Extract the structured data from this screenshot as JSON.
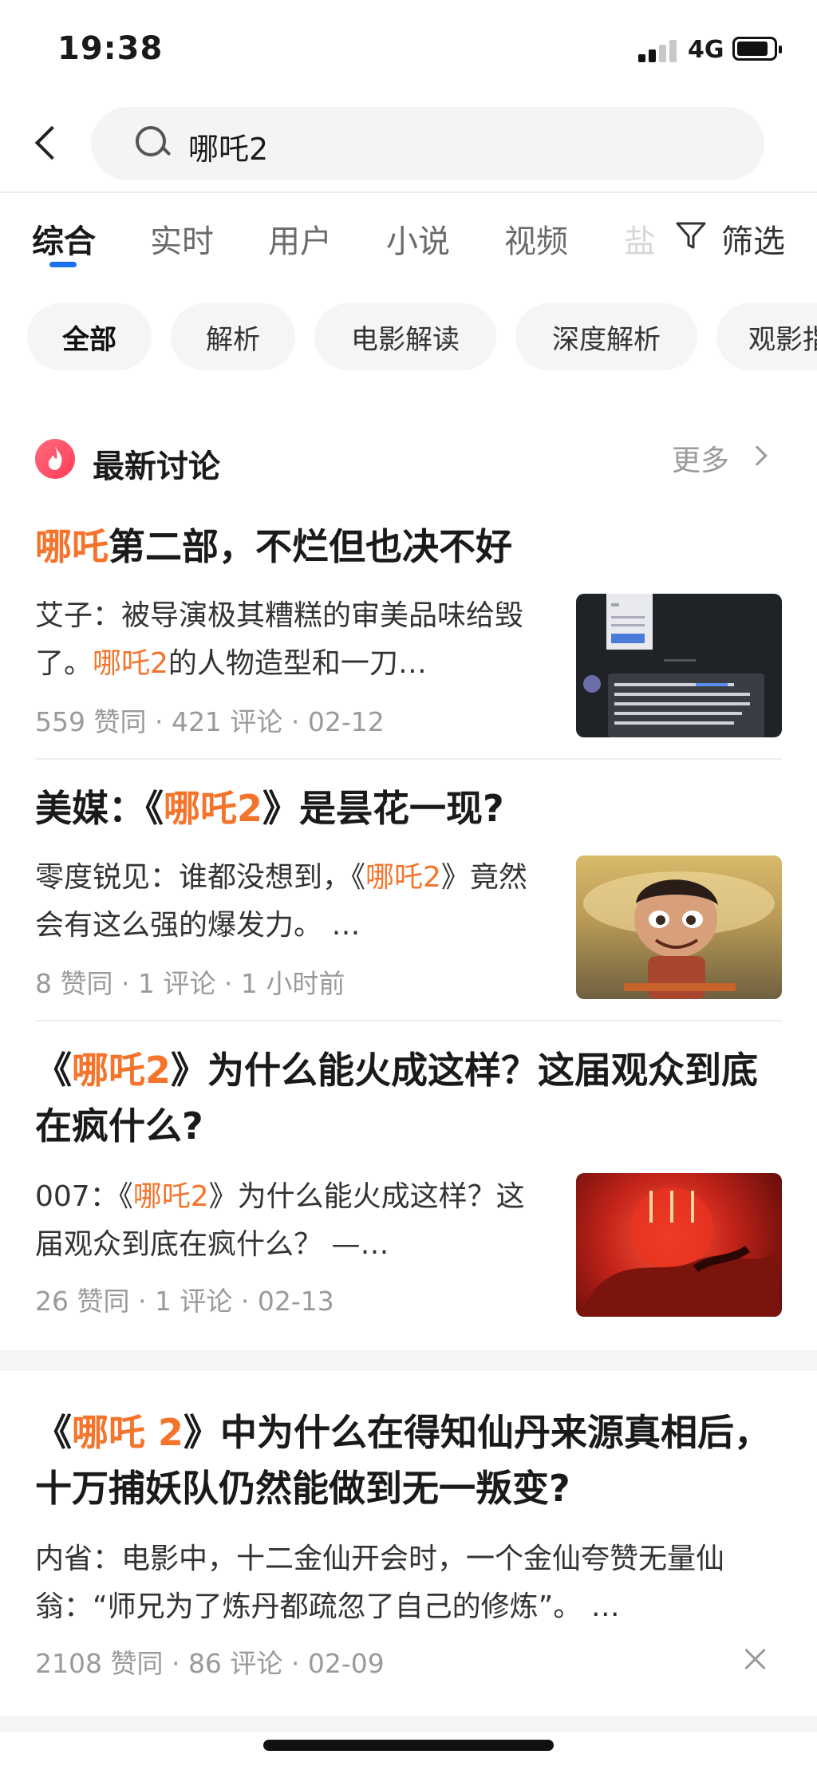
{
  "status": {
    "time": "19:38",
    "network": "4G"
  },
  "search": {
    "query": "哪吒2"
  },
  "tabs": [
    {
      "label": "综合",
      "active": true
    },
    {
      "label": "实时"
    },
    {
      "label": "用户"
    },
    {
      "label": "小说"
    },
    {
      "label": "视频"
    },
    {
      "label": "盐"
    }
  ],
  "filter_label": "筛选",
  "chips": [
    "全部",
    "解析",
    "电影解读",
    "深度解析",
    "观影指"
  ],
  "section": {
    "title": "最新讨论",
    "more": "更多"
  },
  "items": [
    {
      "title_hl": "哪吒",
      "title_rest": "第二部，不烂但也决不好",
      "excerpt_pre": "艾子：被导演极其糟糕的审美品味给毁了。",
      "excerpt_hl": "哪吒2",
      "excerpt_post": "的人物造型和一刀…",
      "meta": "559 赞同 · 421 评论 · 02-12",
      "thumb": "chat-screenshot"
    },
    {
      "title_pre": "美媒：《",
      "title_hl": "哪吒2",
      "title_post": "》是昙花一现?",
      "excerpt_pre": "零度锐见：谁都没想到，《",
      "excerpt_hl": "哪吒2",
      "excerpt_post": "》竟然会有这么强的爆发力。 …",
      "meta": "8 赞同 · 1 评论 · 1 小时前",
      "thumb": "nezha-character"
    },
    {
      "title_pre": "《",
      "title_hl": "哪吒2",
      "title_post": "》为什么能火成这样？这届观众到底在疯什么?",
      "excerpt_pre": "007：《",
      "excerpt_hl": "哪吒2",
      "excerpt_post": "》为什么能火成这样？这届观众到底在疯什么？ —…",
      "meta": "26 赞同 · 1 评论 · 02-13",
      "thumb": "red-dragon-poster"
    },
    {
      "title_pre": "《",
      "title_hl": "哪吒 2",
      "title_post": "》中为什么在得知仙丹来源真相后，十万捕妖队仍然能做到无一叛变?",
      "excerpt": "内省：电影中，十二金仙开会时，一个金仙夸赞无量仙翁：“师兄为了炼丹都疏忽了自己的修炼”。 …",
      "meta": "2108 赞同 · 86 评论 · 02-09"
    }
  ],
  "colors": {
    "accent": "#1d6ff2",
    "highlight": "#f4742b",
    "meta": "#9a9a9a",
    "fire_icon": "#ff4d64"
  },
  "icons": [
    "back-icon",
    "search-icon",
    "filter-icon",
    "fire-icon",
    "chevron-right-icon",
    "close-icon"
  ]
}
